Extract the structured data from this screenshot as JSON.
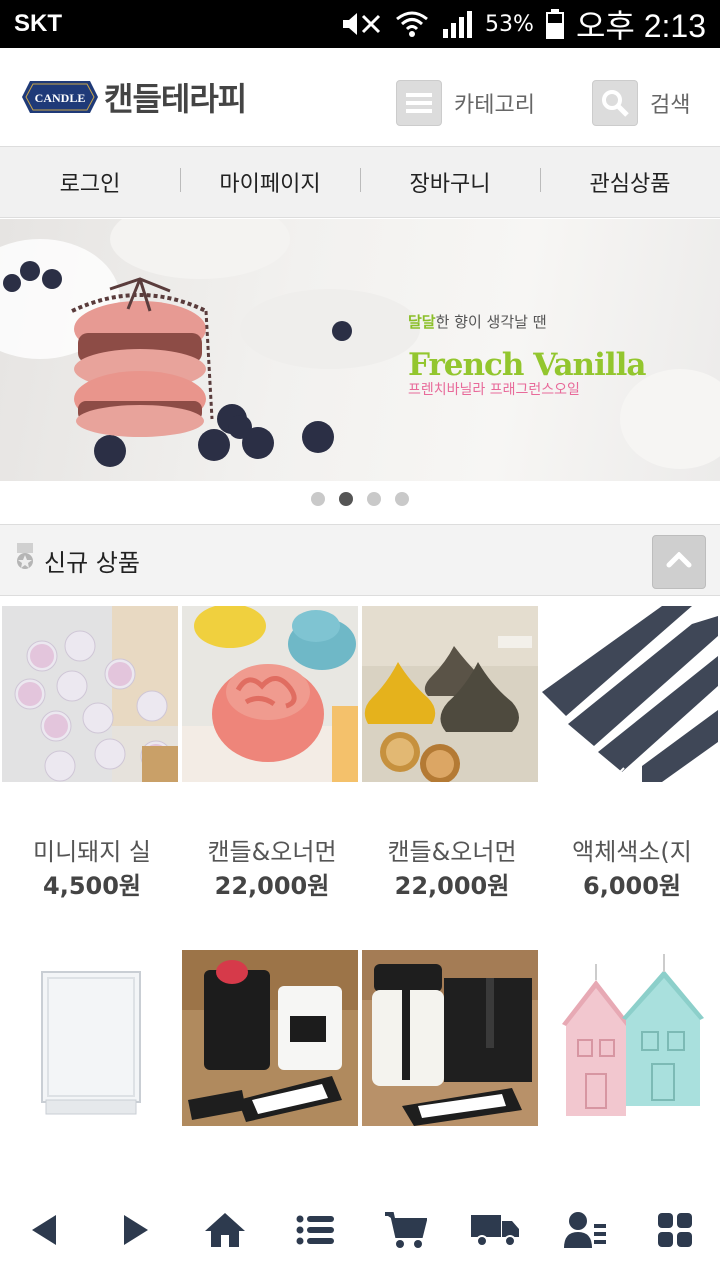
{
  "status_bar": {
    "carrier": "SKT",
    "battery": "53%",
    "time": "오후 2:13"
  },
  "header": {
    "logo_badge_text": "CANDLE",
    "logo_text": "캔들테라피",
    "category_label": "카테고리",
    "search_label": "검색"
  },
  "top_nav": {
    "items": [
      "로그인",
      "마이페이지",
      "장바구니",
      "관심상품"
    ]
  },
  "banner": {
    "line1_highlight": "달달",
    "line1_rest": "한 향이 생각날 땐",
    "title": "French Vanilla",
    "subtitle": "프렌치바닐라 프래그런스오일",
    "slide_count": 4,
    "active_slide": 2
  },
  "section": {
    "title": "신규 상품"
  },
  "products": [
    {
      "name": "미니돼지 실",
      "price": "4,500원"
    },
    {
      "name": "캔들&오너먼",
      "price": "22,000원"
    },
    {
      "name": "캔들&오너먼",
      "price": "22,000원"
    },
    {
      "name": "액체색소(지",
      "price": "6,000원"
    },
    {
      "name": "",
      "price": ""
    },
    {
      "name": "",
      "price": ""
    },
    {
      "name": "",
      "price": ""
    },
    {
      "name": "",
      "price": ""
    }
  ],
  "bottom_nav": {
    "icons": [
      "back-icon",
      "forward-icon",
      "home-icon",
      "list-icon",
      "cart-icon",
      "delivery-truck-icon",
      "member-icon",
      "grid-menu-icon"
    ]
  },
  "colors": {
    "banner_title": "#93c62e",
    "banner_subtitle": "#e86a9a",
    "logo_badge": "#1f3a78"
  }
}
